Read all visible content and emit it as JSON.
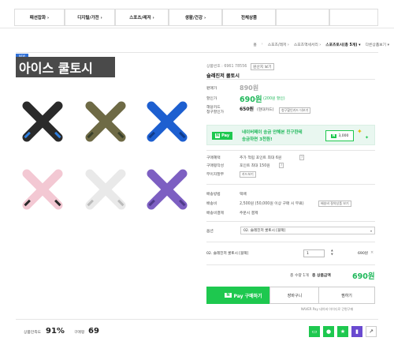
{
  "topnav": {
    "categories": [
      "패션잡화 ›",
      "디지털/가전 ›",
      "스포츠/레저 ›",
      "생활/건강 ›",
      "전체상품"
    ]
  },
  "breadcrumb": {
    "home": "홈",
    "items": [
      "스포츠/레저 ›",
      "스포츠액세서리 ›",
      "스포츠토시(총 5개) ▾",
      "다른상품보기 ▾"
    ]
  },
  "gallery": {
    "badge": "NEW",
    "title": "아이스 쿨토시",
    "sleeves": [
      {
        "name": "black",
        "color": "#2a2a2a",
        "accent": "#2f7fe0"
      },
      {
        "name": "camo",
        "color": "#6e6a45",
        "accent": "#39402a"
      },
      {
        "name": "blue",
        "color": "#1d5fd0",
        "accent": "#0e3a8a"
      },
      {
        "name": "pink",
        "color": "#f3c8d3",
        "accent": "#2a2a2a"
      },
      {
        "name": "white",
        "color": "#e9e9e9",
        "accent": "#bbbbbb"
      },
      {
        "name": "purple",
        "color": "#7d5fc2",
        "accent": "#4f3a8a"
      }
    ]
  },
  "product": {
    "code_label": "상품번호 : 6961 78556",
    "code_badge": "원산지 보기",
    "name": "슬레진저 쿨토시",
    "orig_label": "판매가",
    "orig_price": "890원",
    "sale_label": "할인가",
    "sale_price": "690원",
    "sale_badge": "(200원 할인)",
    "card_label": "해당카드\n청구할인가",
    "card_price": "650원",
    "card_sub": "(현대카드)",
    "card_btn": "청구할인카드 더보기"
  },
  "npay": {
    "logo": "Pay",
    "line1": "네이버페이 송금 안해본 친구한테",
    "line2": "송금하면 3천원!",
    "badge": "3,000"
  },
  "benefits": [
    {
      "k": "구매혜택",
      "v": "추가 적립 포인트 최대 6원"
    },
    {
      "k": "구매평작성",
      "v": "포인트 최대 150원"
    },
    {
      "k": "무이자할부",
      "v": "카드보기"
    }
  ],
  "shipping": [
    {
      "k": "배송방법",
      "v": "택배"
    },
    {
      "k": "배송비",
      "v": "2,500원 (50,000원 이상 구매 시 무료)"
    },
    {
      "k": "배송비결제",
      "v": "주문시 결제"
    }
  ],
  "shipping_btn": "배송비 절약상품 보기",
  "option": {
    "label": "옵션",
    "selected": "02. 슬레진저 쿨토시 [블랙]"
  },
  "selected_item": {
    "name": "02. 슬레진저 쿨토시 [블랙]",
    "qty": "1",
    "price": "690원"
  },
  "total": {
    "qty_text": "총 수량 1개",
    "label": "총 상품금액",
    "amount": "690원"
  },
  "buttons": {
    "buy": "Pay 구매하기",
    "cart": "장바구니",
    "wish": "찜하기",
    "naverpay_note": "NAVER Pay 네이버 아이디로 간편구매"
  },
  "stats": {
    "satisfaction_label": "상품만족도",
    "satisfaction_value": "91%",
    "reviews_label": "구매평",
    "reviews_value": "69"
  },
  "share_icons": [
    "talk-icon",
    "naver-icon",
    "star-icon",
    "purple-icon",
    "share-icon"
  ],
  "colors": {
    "accent": "#1fb85a",
    "npay": "#1ec84f"
  }
}
